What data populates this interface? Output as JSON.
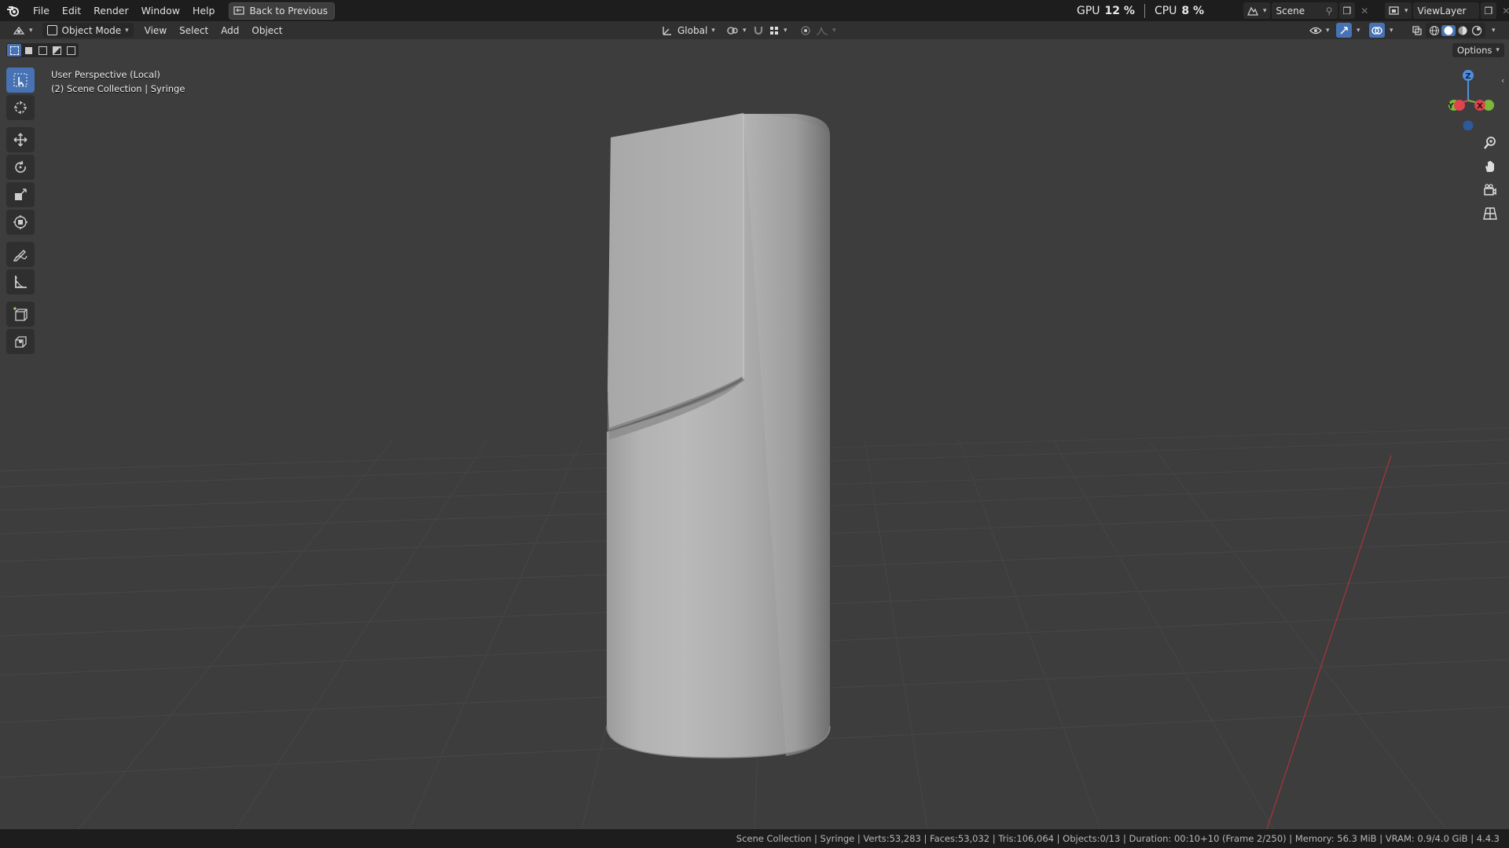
{
  "menu": {
    "items": [
      "File",
      "Edit",
      "Render",
      "Window",
      "Help"
    ],
    "back_button": "Back to Previous"
  },
  "stats": {
    "gpu_label": "GPU",
    "gpu_value": "12 %",
    "cpu_label": "CPU",
    "cpu_value": "8 %"
  },
  "scene": {
    "name": "Scene",
    "view_layer": "ViewLayer"
  },
  "header": {
    "mode": "Object Mode",
    "menus": [
      "View",
      "Select",
      "Add",
      "Object"
    ],
    "orientation": "Global",
    "options": "Options"
  },
  "viewport": {
    "perspective": "User Perspective (Local)",
    "collection": "(2) Scene Collection | Syringe",
    "gizmo": {
      "z": "Z",
      "y": "Y",
      "x": "X"
    }
  },
  "status": "Scene Collection | Syringe | Verts:53,283 | Faces:53,032 | Tris:106,064 | Objects:0/13 | Duration: 00:10+10 (Frame 2/250) | Memory: 56.3 MiB | VRAM: 0.9/4.0 GiB | 4.4.3",
  "colors": {
    "accent": "#4772b3",
    "x_axis": "#e0444e",
    "y_axis": "#7bb83a",
    "z_axis": "#4f8fe0"
  }
}
